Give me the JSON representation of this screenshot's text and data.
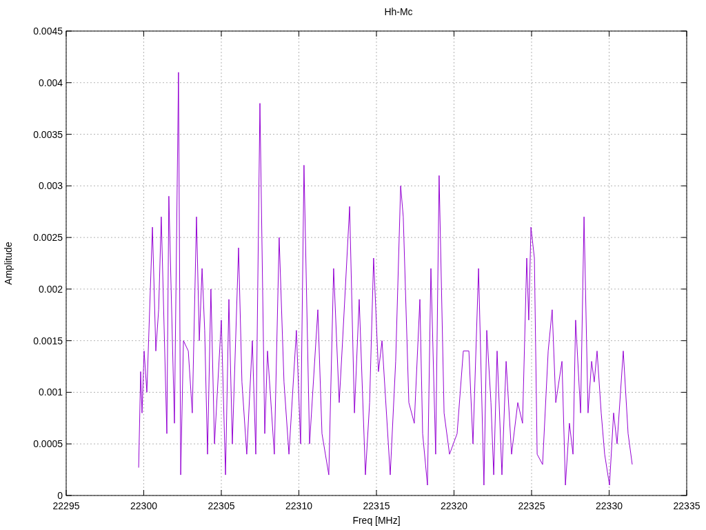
{
  "chart_data": {
    "type": "line",
    "title": "Hh-Mc",
    "xlabel": "Freq [MHz]",
    "ylabel": "Amplitude",
    "x": [
      22299.67,
      22299.8,
      22299.89,
      22300.02,
      22300.2,
      22300.56,
      22300.78,
      22300.96,
      22301.13,
      22301.49,
      22301.62,
      22301.98,
      22302.24,
      22302.38,
      22302.56,
      22302.87,
      22303.13,
      22303.4,
      22303.58,
      22303.76,
      22303.93,
      22304.11,
      22304.33,
      22304.56,
      22305.0,
      22305.27,
      22305.49,
      22305.71,
      22306.11,
      22306.33,
      22306.64,
      22307.0,
      22307.22,
      22307.49,
      22307.8,
      22307.98,
      22308.42,
      22308.73,
      22309.04,
      22309.36,
      22309.84,
      22310.11,
      22310.33,
      22310.69,
      22311.22,
      22311.49,
      22311.93,
      22312.24,
      22312.6,
      22312.82,
      22313.27,
      22313.58,
      22313.89,
      22314.29,
      22314.56,
      22314.82,
      22315.13,
      22315.36,
      22315.89,
      22316.24,
      22316.56,
      22316.73,
      22317.09,
      22317.44,
      22317.8,
      22317.98,
      22318.29,
      22318.51,
      22318.82,
      22319.04,
      22319.36,
      22319.71,
      22320.2,
      22320.6,
      22320.96,
      22321.22,
      22321.58,
      22321.93,
      22322.11,
      22322.38,
      22322.56,
      22322.78,
      22323.09,
      22323.36,
      22323.71,
      22324.11,
      22324.42,
      22324.69,
      22324.82,
      22324.96,
      22325.18,
      22325.36,
      22325.71,
      22326.07,
      22326.33,
      22326.56,
      22326.96,
      22327.18,
      22327.44,
      22327.67,
      22327.84,
      22328.16,
      22328.38,
      22328.64,
      22328.87,
      22329.04,
      22329.22,
      22329.49,
      22329.71,
      22330.02,
      22330.29,
      22330.51,
      22330.91,
      22331.22,
      22331.49
    ],
    "series": [
      {
        "color": "#9400d3",
        "values": [
          0.00027,
          0.0012,
          0.0008,
          0.0014,
          0.001,
          0.0026,
          0.0014,
          0.0018,
          0.0027,
          0.0006,
          0.0029,
          0.0007,
          0.0041,
          0.0002,
          0.0015,
          0.0014,
          0.0008,
          0.0027,
          0.0015,
          0.0022,
          0.0016,
          0.0004,
          0.002,
          0.0005,
          0.0017,
          0.0002,
          0.0019,
          0.0005,
          0.0024,
          0.0011,
          0.0004,
          0.0015,
          0.0004,
          0.0038,
          0.0006,
          0.0014,
          0.0004,
          0.0025,
          0.0011,
          0.0004,
          0.0016,
          0.0005,
          0.0032,
          0.0005,
          0.0018,
          0.0006,
          0.0002,
          0.0022,
          0.0009,
          0.0015,
          0.0028,
          0.0008,
          0.0019,
          0.0002,
          0.0009,
          0.0023,
          0.0012,
          0.0015,
          0.0002,
          0.0013,
          0.003,
          0.0027,
          0.0009,
          0.0007,
          0.0019,
          0.0006,
          0.0001,
          0.0022,
          0.0004,
          0.0031,
          0.0008,
          0.0004,
          0.0006,
          0.0014,
          0.0014,
          0.0005,
          0.0022,
          0.0001,
          0.0016,
          0.0009,
          0.0002,
          0.0014,
          0.0002,
          0.0013,
          0.0004,
          0.0009,
          0.0007,
          0.0023,
          0.0017,
          0.0026,
          0.0023,
          0.0004,
          0.0003,
          0.0014,
          0.0018,
          0.0009,
          0.0013,
          0.0001,
          0.0007,
          0.0004,
          0.0017,
          0.0008,
          0.0027,
          0.0008,
          0.0013,
          0.0011,
          0.0014,
          0.0008,
          0.0004,
          0.0001,
          0.0008,
          0.0005,
          0.0014,
          0.0006,
          0.0003
        ]
      }
    ],
    "grid": true,
    "xlim": [
      22295,
      22335
    ],
    "ylim": [
      0,
      0.0045
    ],
    "xticks": [
      22295,
      22300,
      22305,
      22310,
      22315,
      22320,
      22325,
      22330,
      22335
    ],
    "yticks": [
      0,
      0.0005,
      0.001,
      0.0015,
      0.002,
      0.0025,
      0.003,
      0.0035,
      0.004,
      0.0045
    ]
  }
}
